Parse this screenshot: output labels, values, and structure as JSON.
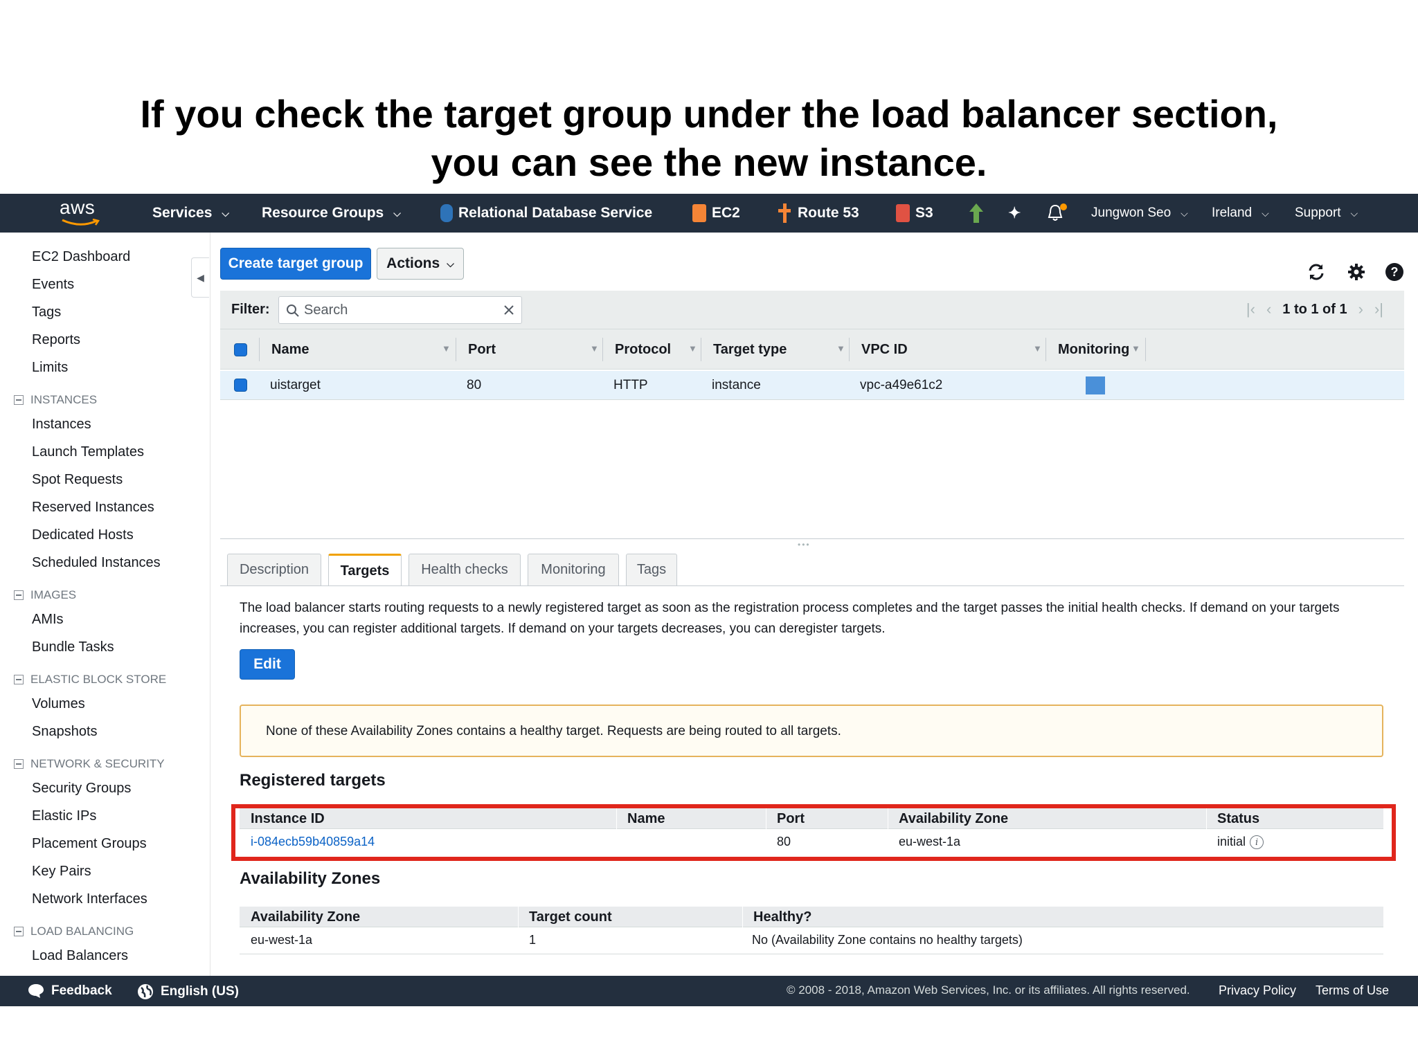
{
  "caption": {
    "line1": "If you check the target group under the load balancer section,",
    "line2": "you can see the new instance."
  },
  "topnav": {
    "logo": "aws",
    "services": "Services",
    "resource_groups": "Resource Groups",
    "shortcuts": [
      {
        "label": "Relational Database Service",
        "icon": "rds-icon",
        "color": "#2e73b8"
      },
      {
        "label": "EC2",
        "icon": "ec2-icon",
        "color": "#f58536"
      },
      {
        "label": "Route 53",
        "icon": "route53-icon",
        "color": "#f58536"
      },
      {
        "label": "S3",
        "icon": "s3-icon",
        "color": "#e05243"
      }
    ],
    "user": "Jungwon Seo",
    "region": "Ireland",
    "support": "Support",
    "accent_color": "#ff9900"
  },
  "sidebar": {
    "top_items": [
      "EC2 Dashboard",
      "Events",
      "Tags",
      "Reports",
      "Limits"
    ],
    "sections": [
      {
        "title": "INSTANCES",
        "items": [
          "Instances",
          "Launch Templates",
          "Spot Requests",
          "Reserved Instances",
          "Dedicated Hosts",
          "Scheduled Instances"
        ]
      },
      {
        "title": "IMAGES",
        "items": [
          "AMIs",
          "Bundle Tasks"
        ]
      },
      {
        "title": "ELASTIC BLOCK STORE",
        "items": [
          "Volumes",
          "Snapshots"
        ]
      },
      {
        "title": "NETWORK & SECURITY",
        "items": [
          "Security Groups",
          "Elastic IPs",
          "Placement Groups",
          "Key Pairs",
          "Network Interfaces"
        ]
      },
      {
        "title": "LOAD BALANCING",
        "items": [
          "Load Balancers"
        ]
      }
    ]
  },
  "toolbar": {
    "create_label": "Create target group",
    "actions_label": "Actions"
  },
  "filter": {
    "label": "Filter:",
    "placeholder": "Search",
    "pagination": "1 to 1 of 1"
  },
  "target_groups": {
    "columns": [
      "Name",
      "Port",
      "Protocol",
      "Target type",
      "VPC ID",
      "Monitoring"
    ],
    "rows": [
      {
        "name": "uistarget",
        "port": "80",
        "protocol": "HTTP",
        "target_type": "instance",
        "vpc_id": "vpc-a49e61c2"
      }
    ]
  },
  "tabs": [
    "Description",
    "Targets",
    "Health checks",
    "Monitoring",
    "Tags"
  ],
  "active_tab": "Targets",
  "targets_panel": {
    "description": "The load balancer starts routing requests to a newly registered target as soon as the registration process completes and the target passes the initial health checks. If demand on your targets increases, you can register additional targets. If demand on your targets decreases, you can deregister targets.",
    "edit_label": "Edit",
    "alert": "None of these Availability Zones contains a healthy target. Requests are being routed to all targets.",
    "registered_title": "Registered targets",
    "registered_columns": [
      "Instance ID",
      "Name",
      "Port",
      "Availability Zone",
      "Status"
    ],
    "registered_rows": [
      {
        "instance_id": "i-084ecb59b40859a14",
        "name": "",
        "port": "80",
        "zone": "eu-west-1a",
        "status": "initial"
      }
    ],
    "zones_title": "Availability Zones",
    "zones_columns": [
      "Availability Zone",
      "Target count",
      "Healthy?"
    ],
    "zones_rows": [
      {
        "zone": "eu-west-1a",
        "count": "1",
        "healthy": "No (Availability Zone contains no healthy targets)"
      }
    ]
  },
  "footer": {
    "feedback": "Feedback",
    "language": "English (US)",
    "copyright": "© 2008 - 2018, Amazon Web Services, Inc. or its affiliates. All rights reserved.",
    "privacy": "Privacy Policy",
    "terms": "Terms of Use"
  }
}
